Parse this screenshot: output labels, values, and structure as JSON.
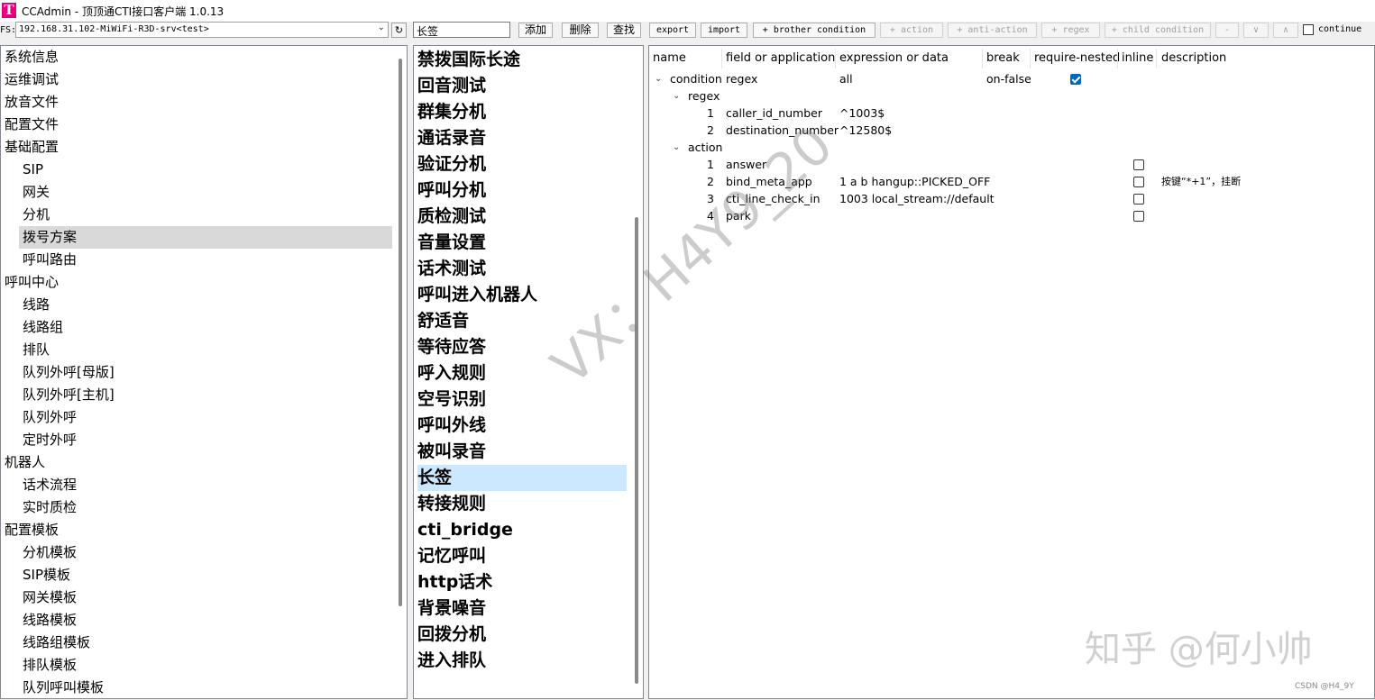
{
  "window": {
    "title": "CCAdmin - 顶顶通CTI接口客户端 1.0.13",
    "icon_letter": "T"
  },
  "toolbar": {
    "fs_label": "FS:",
    "fs_value": "192.168.31.102-MiWiFi-R3D-srv<test>",
    "search_value": "长签",
    "buttons": [
      "添加",
      "删除",
      "查找",
      "export",
      "import",
      "+ brother condition",
      "+ action",
      "+ anti-action",
      "+ regex",
      "+ child condition",
      "-",
      "∨",
      "∧"
    ],
    "continue_label": "continue"
  },
  "left_tree": [
    {
      "label": "系统信息",
      "level": 0
    },
    {
      "label": "运维调试",
      "level": 0
    },
    {
      "label": "放音文件",
      "level": 0
    },
    {
      "label": "配置文件",
      "level": 0
    },
    {
      "label": "基础配置",
      "level": 0
    },
    {
      "label": "SIP",
      "level": 1
    },
    {
      "label": "网关",
      "level": 1
    },
    {
      "label": "分机",
      "level": 1
    },
    {
      "label": "拨号方案",
      "level": 1,
      "selected": true
    },
    {
      "label": "呼叫路由",
      "level": 1
    },
    {
      "label": "呼叫中心",
      "level": 0
    },
    {
      "label": "线路",
      "level": 1
    },
    {
      "label": "线路组",
      "level": 1
    },
    {
      "label": "排队",
      "level": 1
    },
    {
      "label": "队列外呼[母版]",
      "level": 1
    },
    {
      "label": "队列外呼[主机]",
      "level": 1
    },
    {
      "label": "队列外呼",
      "level": 1
    },
    {
      "label": "定时外呼",
      "level": 1
    },
    {
      "label": "机器人",
      "level": 0
    },
    {
      "label": "话术流程",
      "level": 1
    },
    {
      "label": "实时质检",
      "level": 1
    },
    {
      "label": "配置模板",
      "level": 0
    },
    {
      "label": "分机模板",
      "level": 1
    },
    {
      "label": "SIP模板",
      "level": 1
    },
    {
      "label": "网关模板",
      "level": 1
    },
    {
      "label": "线路模板",
      "level": 1
    },
    {
      "label": "线路组模板",
      "level": 1
    },
    {
      "label": "排队模板",
      "level": 1
    },
    {
      "label": "队列呼叫模板",
      "level": 1
    }
  ],
  "dialplans": [
    "禁拨国际长途",
    "回音测试",
    "群集分机",
    "通话录音",
    "验证分机",
    "呼叫分机",
    "质检测试",
    "音量设置",
    "话术测试",
    "呼叫进入机器人",
    "舒适音",
    "等待应答",
    "呼入规则",
    "空号识别",
    "呼叫外线",
    "被叫录音",
    "长签",
    "转接规则",
    "cti_bridge",
    "记忆呼叫",
    "http话术",
    "背景噪音",
    "回拨分机",
    "进入排队"
  ],
  "dialplan_selected": 16,
  "table": {
    "columns": [
      "name",
      "field or application",
      "expression or data",
      "break",
      "require-nested",
      "inline",
      "description"
    ],
    "condition": {
      "name": "condition",
      "field": "regex",
      "expression": "all",
      "break": "on-false",
      "require_nested": true
    },
    "regex_label": "regex",
    "regex": [
      {
        "num": "1",
        "field": "caller_id_number",
        "expr": "^1003$"
      },
      {
        "num": "2",
        "field": "destination_number",
        "expr": "^12580$"
      }
    ],
    "action_label": "action",
    "actions": [
      {
        "num": "1",
        "app": "answer",
        "data": "",
        "desc": ""
      },
      {
        "num": "2",
        "app": "bind_meta_app",
        "data": "1 a b hangup::PICKED_OFF",
        "desc": "按键“*+1”，挂断"
      },
      {
        "num": "3",
        "app": "cti_line_check_in",
        "data": "1003 local_stream://default",
        "desc": ""
      },
      {
        "num": "4",
        "app": "park",
        "data": "",
        "desc": ""
      }
    ]
  },
  "watermarks": {
    "diagonal": "VX：H4Y9_20",
    "zhihu": "知乎 @何小帅",
    "csdn": "CSDN @H4_9Y"
  },
  "colors": {
    "selected_blue": "#cce8ff",
    "selected_gray": "#d9d9d9",
    "icon_pink": "#e6007e",
    "check_blue": "#0067c0"
  }
}
